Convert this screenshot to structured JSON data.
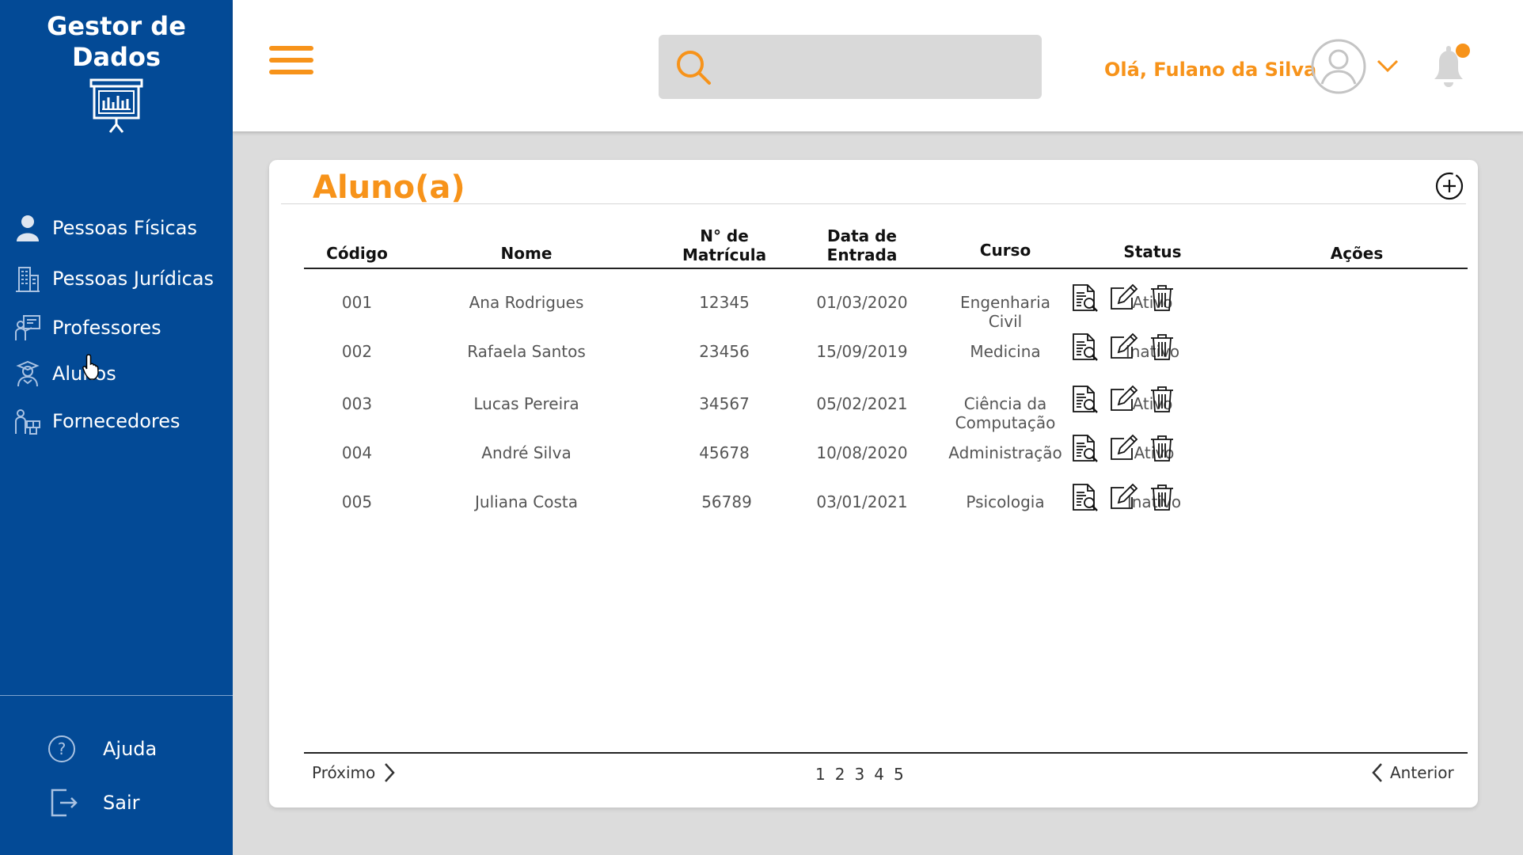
{
  "sidebar": {
    "brand": "Gestor de Dados",
    "items": [
      {
        "label": "Pessoas Físicas",
        "icon": "person-icon"
      },
      {
        "label": "Pessoas Jurídicas",
        "icon": "building-icon"
      },
      {
        "label": "Professores",
        "icon": "teacher-icon"
      },
      {
        "label": "Alunos",
        "icon": "student-icon"
      },
      {
        "label": "Fornecedores",
        "icon": "supplier-icon"
      }
    ],
    "help_label": "Ajuda",
    "logout_label": "Sair"
  },
  "header": {
    "search_placeholder": "",
    "greeting": "Olá, Fulano da Silva"
  },
  "card": {
    "title": "Aluno(a)",
    "columns": {
      "codigo": "Código",
      "nome": "Nome",
      "matricula_1": "N° de",
      "matricula_2": "Matrícula",
      "data_1": "Data de",
      "data_2": "Entrada",
      "curso": "Curso",
      "status": "Status",
      "acoes": "Ações"
    },
    "rows": [
      {
        "codigo": "001",
        "nome": "Ana Rodrigues",
        "matricula": "12345",
        "data": "01/03/2020",
        "curso": "Engenharia Civil",
        "status": "Ativo"
      },
      {
        "codigo": "002",
        "nome": "Rafaela Santos",
        "matricula": "23456",
        "data": "15/09/2019",
        "curso": "Medicina",
        "status": "Inativo"
      },
      {
        "codigo": "003",
        "nome": "Lucas Pereira",
        "matricula": "34567",
        "data": "05/02/2021",
        "curso": "Ciência da Computação",
        "status": "Ativo"
      },
      {
        "codigo": "004",
        "nome": "André Silva",
        "matricula": "45678",
        "data": "10/08/2020",
        "curso": "Administração",
        "status": "Ativo"
      },
      {
        "codigo": "005",
        "nome": "Juliana Costa",
        "matricula": "56789",
        "data": "03/01/2021",
        "curso": "Psicologia",
        "status": "Inativo"
      }
    ],
    "pager": {
      "next_label": "Próximo",
      "prev_label": "Anterior",
      "pages": [
        "1",
        "2",
        "3",
        "4",
        "5"
      ]
    }
  },
  "colors": {
    "sidebar": "#034a96",
    "accent": "#f7931a",
    "notification_dot": "#f7931a"
  }
}
